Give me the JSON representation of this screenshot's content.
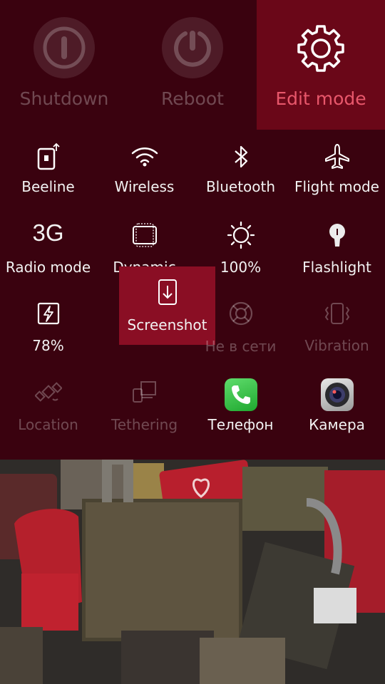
{
  "power": {
    "shutdown_label": "Shutdown",
    "reboot_label": "Reboot",
    "edit_label": "Edit mode"
  },
  "toggles": {
    "beeline": "Beeline",
    "wireless": "Wireless",
    "bluetooth": "Bluetooth",
    "flight": "Flight mode",
    "radio_value": "3G",
    "radio": "Radio mode",
    "dynamic": "Dynamic",
    "brightness": "100%",
    "flashlight": "Flashlight",
    "battery": "78%",
    "screenshot": "Screenshot",
    "offline": "Не в сети",
    "vibration": "Vibration",
    "location": "Location",
    "tethering": "Tethering",
    "phone": "Телефон",
    "camera": "Камера"
  },
  "colors": {
    "panel_bg": "#3a020f",
    "accent": "#e8576b",
    "highlight_tile": "#8a0e24"
  }
}
